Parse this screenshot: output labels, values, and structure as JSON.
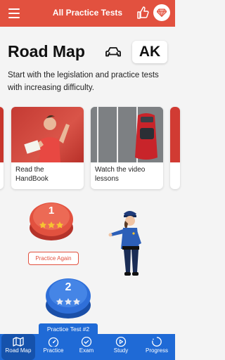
{
  "topbar": {
    "title": "All Practice Tests",
    "menu_icon": "hamburger-menu-icon",
    "like_icon": "thumbs-up-icon",
    "premium_icon": "diamond-icon"
  },
  "header": {
    "title": "Road Map",
    "car_icon": "car-icon",
    "state": "AK"
  },
  "subtitle": "Start with the legislation and practice tests with increasing difficulty.",
  "cards": [
    {
      "label": "Read the HandBook"
    },
    {
      "label": "Watch the video lessons"
    }
  ],
  "levels": [
    {
      "number": "1",
      "stars": 3,
      "color": "#e2513f",
      "action": "Practice Again"
    },
    {
      "number": "2",
      "stars": 3,
      "color": "#1f6ad6",
      "action": "Practice Test #2"
    }
  ],
  "bottom_nav": [
    {
      "label": "Road Map",
      "icon": "road-map-icon",
      "active": true
    },
    {
      "label": "Practice",
      "icon": "speedometer-icon",
      "active": false
    },
    {
      "label": "Exam",
      "icon": "check-circle-icon",
      "active": false
    },
    {
      "label": "Study",
      "icon": "play-circle-icon",
      "active": false
    },
    {
      "label": "Progress",
      "icon": "progress-icon",
      "active": false
    }
  ],
  "colors": {
    "accent": "#e2513f",
    "nav_blue": "#1f6ad6",
    "background": "#f4f4f4"
  }
}
